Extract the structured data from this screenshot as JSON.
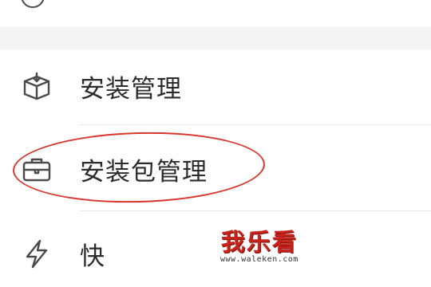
{
  "top_item": {
    "icon": "circle-icon"
  },
  "items": [
    {
      "label": "安装管理",
      "icon": "package-box-icon"
    },
    {
      "label": "安装包管理",
      "icon": "briefcase-icon"
    },
    {
      "label": "快",
      "icon": "lightning-icon"
    }
  ],
  "annotation": {
    "color": "#d9362b"
  },
  "watermark": {
    "title": "我乐看",
    "url": "www.waleken.com",
    "color": "#c8221a"
  }
}
